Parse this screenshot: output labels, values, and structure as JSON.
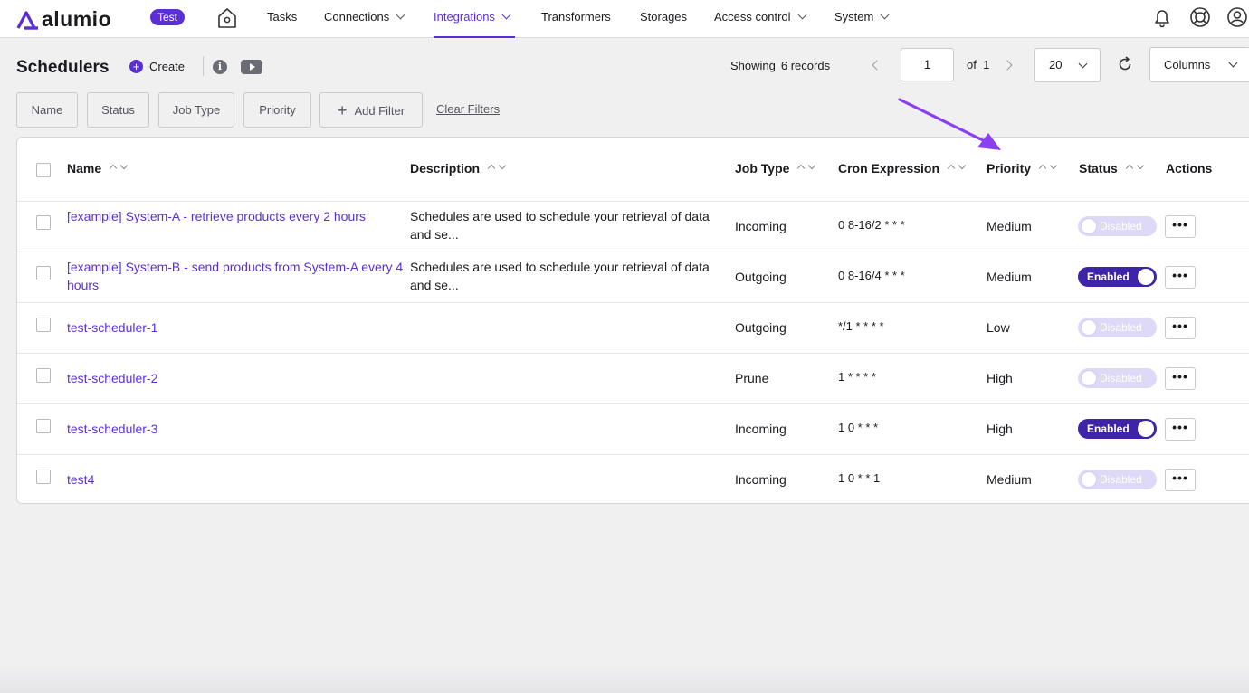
{
  "app": {
    "brand": "alumio",
    "env_badge": "Test"
  },
  "nav": {
    "items": [
      {
        "label": "Tasks"
      },
      {
        "label": "Connections"
      },
      {
        "label": "Integrations"
      },
      {
        "label": "Transformers"
      },
      {
        "label": "Storages"
      },
      {
        "label": "Access control"
      },
      {
        "label": "System"
      }
    ],
    "active": "Integrations"
  },
  "header": {
    "title": "Schedulers",
    "create_label": "Create",
    "showing_label": "Showing",
    "records": "6 records",
    "page": "1",
    "of_label": "of",
    "total_pages": "1",
    "per_page": "20",
    "columns_label": "Columns"
  },
  "filters": {
    "items": [
      {
        "label": "Name"
      },
      {
        "label": "Status"
      },
      {
        "label": "Job Type"
      },
      {
        "label": "Priority"
      }
    ],
    "add_label": "Add Filter",
    "clear_label": "Clear Filters"
  },
  "table": {
    "columns": {
      "name": "Name",
      "description": "Description",
      "job_type": "Job Type",
      "cron": "Cron Expression",
      "priority": "Priority",
      "status": "Status",
      "actions": "Actions"
    },
    "rows": [
      {
        "name": "[example] System-A - retrieve products every 2 hours",
        "description": "Schedules are used to schedule your retrieval of data and se...",
        "job_type": "Incoming",
        "cron": "0 8-16/2 * * *",
        "priority": "Medium",
        "status": "Disabled",
        "enabled": false
      },
      {
        "name": "[example] System-B - send products from System-A every 4 hours",
        "description": "Schedules are used to schedule your retrieval of data and se...",
        "job_type": "Outgoing",
        "cron": "0 8-16/4 * * *",
        "priority": "Medium",
        "status": "Enabled",
        "enabled": true
      },
      {
        "name": "test-scheduler-1",
        "description": "",
        "job_type": "Outgoing",
        "cron": "*/1 * * * *",
        "priority": "Low",
        "status": "Disabled",
        "enabled": false
      },
      {
        "name": "test-scheduler-2",
        "description": "",
        "job_type": "Prune",
        "cron": "1 * * * *",
        "priority": "High",
        "status": "Disabled",
        "enabled": false
      },
      {
        "name": "test-scheduler-3",
        "description": "",
        "job_type": "Incoming",
        "cron": "1 0 * * *",
        "priority": "High",
        "status": "Enabled",
        "enabled": true
      },
      {
        "name": "test4",
        "description": "",
        "job_type": "Incoming",
        "cron": "1 0 * * 1",
        "priority": "Medium",
        "status": "Disabled",
        "enabled": false
      }
    ],
    "more_label": "•••"
  },
  "colors": {
    "accent": "#5b2fd6",
    "toggle_on": "#3d24a8",
    "toggle_off": "#ded9f6",
    "annotation_arrow": "#8a3ff0"
  },
  "icons": [
    "home-icon",
    "bell-icon",
    "help-icon",
    "user-icon",
    "info-icon",
    "video-icon",
    "refresh-icon",
    "plus-icon"
  ]
}
